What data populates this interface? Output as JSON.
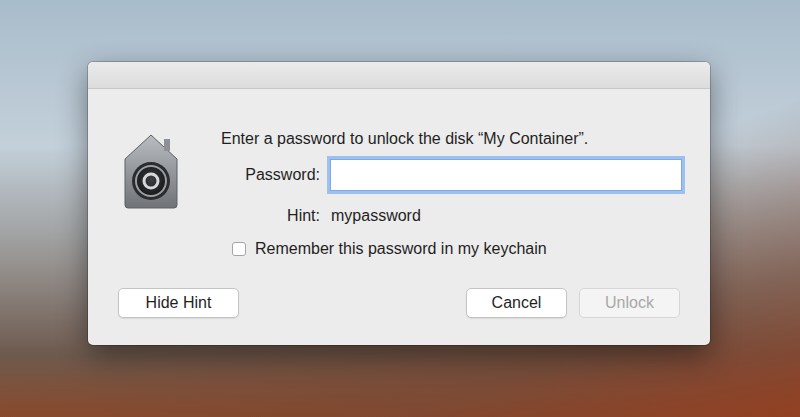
{
  "dialog": {
    "message": "Enter a password to unlock the disk “My Container”.",
    "password_label": "Password:",
    "password_field": {
      "value": "",
      "focused": true
    },
    "hint_label": "Hint:",
    "hint": "mypassword",
    "remember": {
      "label": "Remember this password in my keychain",
      "checked": false
    },
    "buttons": [
      {
        "label": "Hide Hint",
        "disabled": false,
        "kind": "secondary"
      },
      {
        "label": "Cancel",
        "disabled": false,
        "kind": "action"
      },
      {
        "label": "Unlock",
        "disabled": true,
        "kind": "action"
      }
    ]
  }
}
